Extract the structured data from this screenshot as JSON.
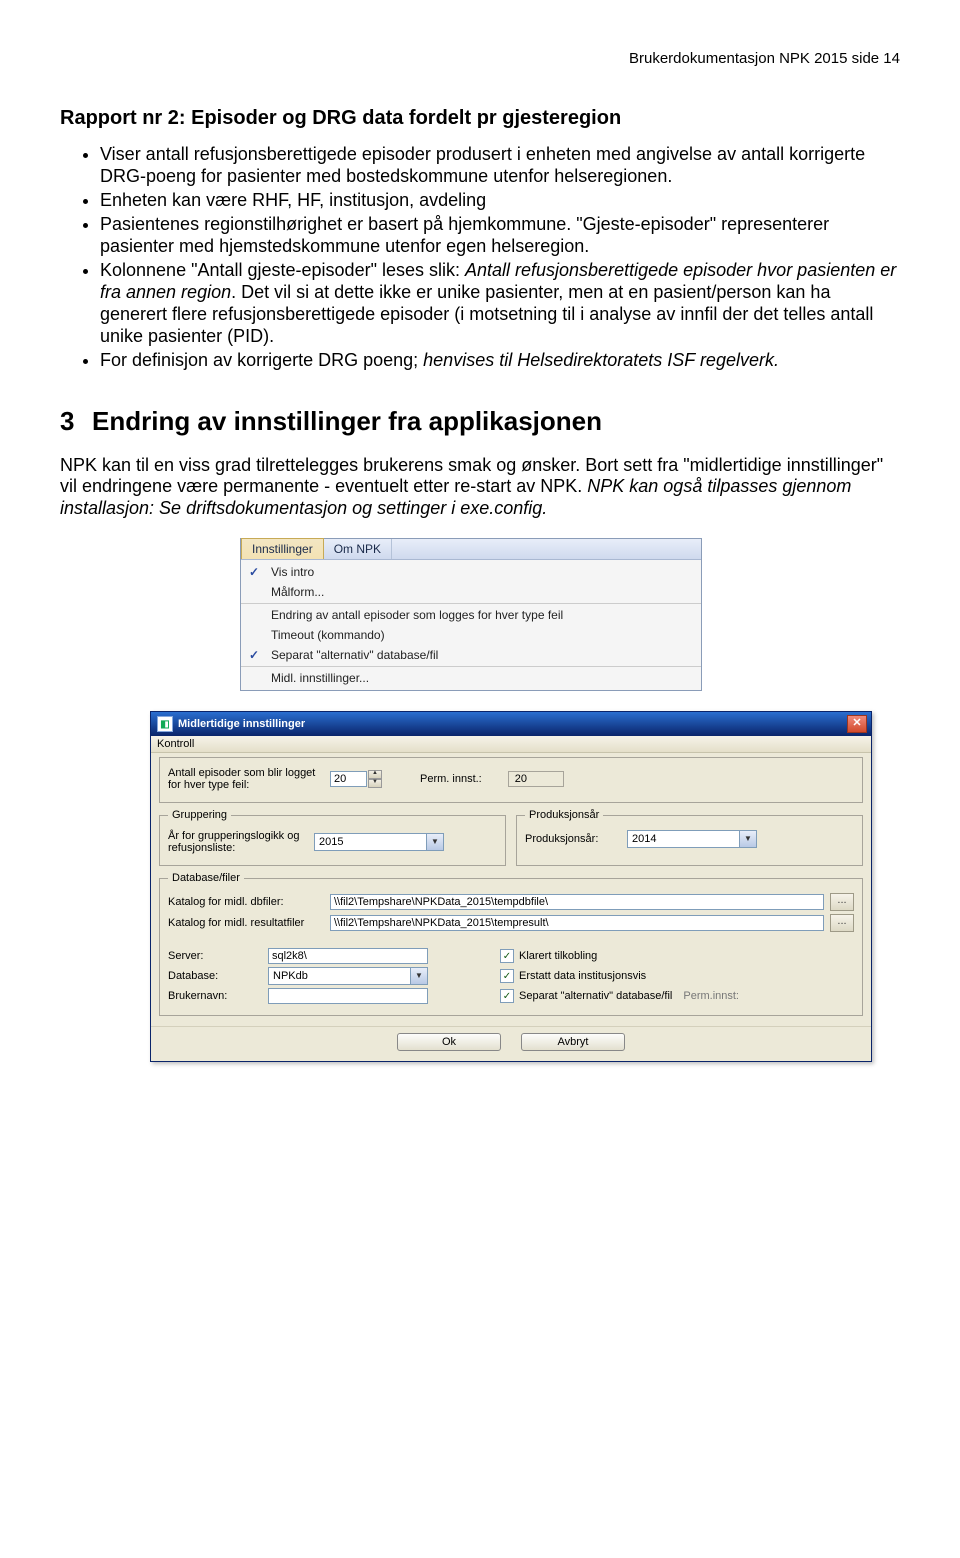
{
  "header": "Brukerdokumentasjon NPK 2015 side 14",
  "report": {
    "title": "Rapport nr 2: Episoder og DRG data fordelt pr gjesteregion",
    "bullets": [
      "Viser antall refusjonsberettigede episoder produsert i enheten med angivelse av antall korrigerte DRG-poeng for pasienter med bostedskommune utenfor helseregionen.",
      "Enheten kan være RHF, HF, institusjon, avdeling",
      "Pasientenes regionstilhørighet er basert på hjemkommune. \"Gjeste-episoder\" representerer pasienter med hjemstedskommune utenfor egen helseregion.",
      "Kolonnene \"Antall gjeste-episoder\" leses slik: Antall refusjonsberettigede episoder hvor pasienten er fra annen region. Det vil si at dette ikke er unike pasienter, men at en pasient/person kan ha generert flere refusjonsberettigede episoder (i motsetning til i analyse av innfil der det telles antall unike pasienter (PID).",
      "For definisjon av korrigerte DRG poeng;  henvises til Helsedirektoratets ISF regelverk."
    ],
    "italicPhrases": {
      "3": "Antall refusjonsberettigede episoder hvor pasienten er fra annen region",
      "4_a": "henvises til Helsedirektoratets ISF regelverk."
    }
  },
  "section3": {
    "num": "3",
    "title": "Endring av innstillinger fra applikasjonen",
    "para": "NPK kan til en viss grad tilrettelegges brukerens smak og ønsker.  Bort sett fra \"midlertidige innstillinger\" vil endringene være permanente - eventuelt etter re-start av NPK.  NPK kan også tilpasses gjennom installasjon:  Se driftsdokumentasjon og settinger i exe.config.",
    "italicTail": "NPK kan også tilpasses gjennom installasjon:  Se driftsdokumentasjon og settinger i exe.config."
  },
  "menu": {
    "tab_active": "Innstillinger",
    "tab_other": "Om NPK",
    "items": [
      {
        "label": "Vis intro",
        "checked": true
      },
      {
        "label": "Målform...",
        "checked": false
      },
      {
        "label": "Endring av antall episoder som logges for hver type feil",
        "checked": false
      },
      {
        "label": "Timeout (kommando)",
        "checked": false
      },
      {
        "label": "Separat \"alternativ\" database/fil",
        "checked": true
      },
      {
        "label": "Midl. innstillinger...",
        "checked": false
      }
    ]
  },
  "dialog": {
    "title": "Midlertidige innstillinger",
    "menubar": "Kontroll",
    "groups": {
      "top_label": "Antall episoder som blir logget for hver type feil:",
      "top_value": "20",
      "perm_label": "Perm. innst.:",
      "perm_value": "20",
      "gruppering_legend": "Gruppering",
      "gruppering_label": "År for grupperingslogikk og refusjonsliste:",
      "gruppering_value": "2015",
      "prod_legend": "Produksjonsår",
      "prod_label": "Produksjonsår:",
      "prod_value": "2014",
      "db_legend": "Database/filer",
      "db_label1": "Katalog for midl. dbfiler:",
      "db_val1": "\\\\fil2\\Tempshare\\NPKData_2015\\tempdbfile\\",
      "db_label2": "Katalog for midl. resultatfiler",
      "db_val2": "\\\\fil2\\Tempshare\\NPKData_2015\\tempresult\\",
      "server_label": "Server:",
      "server_value": "sql2k8\\",
      "database_label": "Database:",
      "database_value": "NPKdb",
      "user_label": "Brukernavn:",
      "cb1": "Klarert tilkobling",
      "cb2": "Erstatt data institusjonsvis",
      "cb3": "Separat \"alternativ\" database/fil",
      "cb3_tail": "Perm.innst:",
      "ok": "Ok",
      "cancel": "Avbryt"
    }
  }
}
